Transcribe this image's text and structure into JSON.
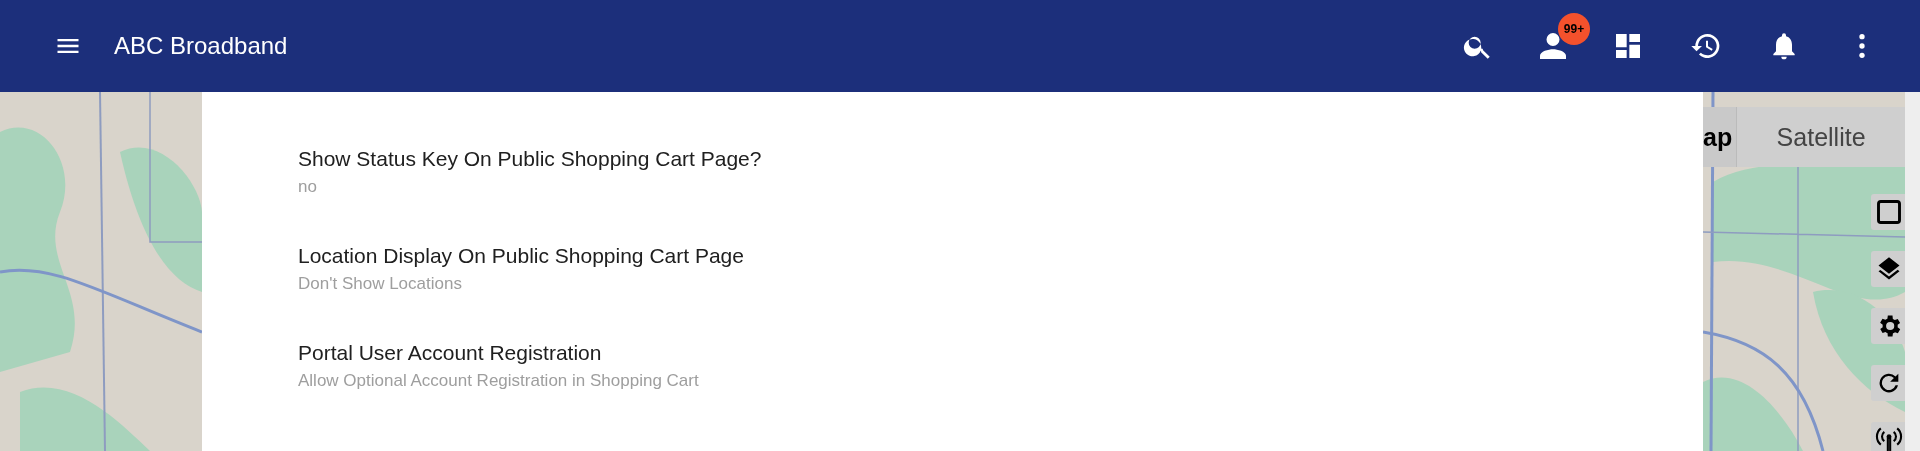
{
  "app_bar": {
    "title": "ABC Broadband",
    "notification_badge": "99+"
  },
  "settings": [
    {
      "title": "Show Status Key On Public Shopping Cart Page?",
      "value": "no"
    },
    {
      "title": "Location Display On Public Shopping Cart Page",
      "value": "Don't Show Locations"
    },
    {
      "title": "Portal User Account Registration",
      "value": "Allow Optional Account Registration in Shopping Cart"
    }
  ],
  "map": {
    "type_buttons": [
      {
        "label": "ap",
        "selected": true
      },
      {
        "label": "Satellite",
        "selected": false
      }
    ]
  }
}
